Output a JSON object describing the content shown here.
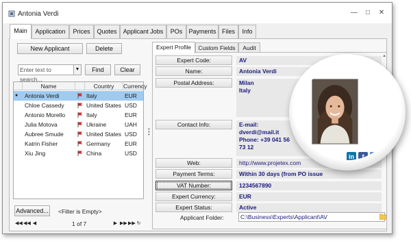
{
  "window": {
    "title": "Antonia Verdi"
  },
  "main_tabs": [
    "Main",
    "Application",
    "Prices",
    "Quotes",
    "Applicant Jobs",
    "POs",
    "Payments",
    "Files",
    "Info"
  ],
  "left_panel": {
    "new_button": "New Applicant",
    "delete_button": "Delete",
    "search_placeholder": "Enter text to search...",
    "find_button": "Find",
    "clear_button": "Clear",
    "columns": [
      "Name",
      "Country",
      "Currency"
    ],
    "rows": [
      {
        "name": "Antonia Verdi",
        "country": "Italy",
        "currency": "EUR"
      },
      {
        "name": "Chloe Cassedy",
        "country": "United States",
        "currency": "USD"
      },
      {
        "name": "Antonio Morello",
        "country": "Italy",
        "currency": "EUR"
      },
      {
        "name": "Julia Motova",
        "country": "Ukraine",
        "currency": "UAH"
      },
      {
        "name": "Aubree Smude",
        "country": "United States",
        "currency": "USD"
      },
      {
        "name": "Katrin Fisher",
        "country": "Germany",
        "currency": "EUR"
      },
      {
        "name": "Xiu Jing",
        "country": "China",
        "currency": "USD"
      }
    ],
    "advanced_button": "Advanced...",
    "filter_text": "<Filter is Empty>",
    "page_indicator": "1 of 7"
  },
  "sub_tabs": [
    "Expert Profile",
    "Custom Fields",
    "Audit"
  ],
  "profile": {
    "expert_code_label": "Expert Code:",
    "expert_code": "AV",
    "name_label": "Name:",
    "name": "Antonia Verdi",
    "postal_label": "Postal Address:",
    "postal_line1": "Milan",
    "postal_line2": "Italy",
    "contact_label": "Contact Info:",
    "contact_line1": "E-mail:",
    "contact_line2": "dverdi@mail.it",
    "contact_line3": "Phone: +39 041 56",
    "contact_line4": "73 12",
    "web_label": "Web:",
    "web": "http://www.projetex.com",
    "terms_label": "Payment Terms:",
    "terms": "Within 30 days (from PO issue",
    "vat_label": "VAT Number:",
    "vat": "1234567890",
    "currency_label": "Expert Currency:",
    "currency": "EUR",
    "status_label": "Expert Status:",
    "status": "Active",
    "folder_label": "Applicant Folder:",
    "folder": "C:\\Business\\Experts\\Applicant\\AV"
  },
  "social": [
    "in",
    "f",
    "t"
  ],
  "colors": {
    "selection": "#9fcbf0",
    "value_text": "#1a1a7c",
    "linkedin": "#0e76a8",
    "facebook": "#3b5998",
    "twitter": "#4a8ad4",
    "flag": "#d42a2a"
  }
}
